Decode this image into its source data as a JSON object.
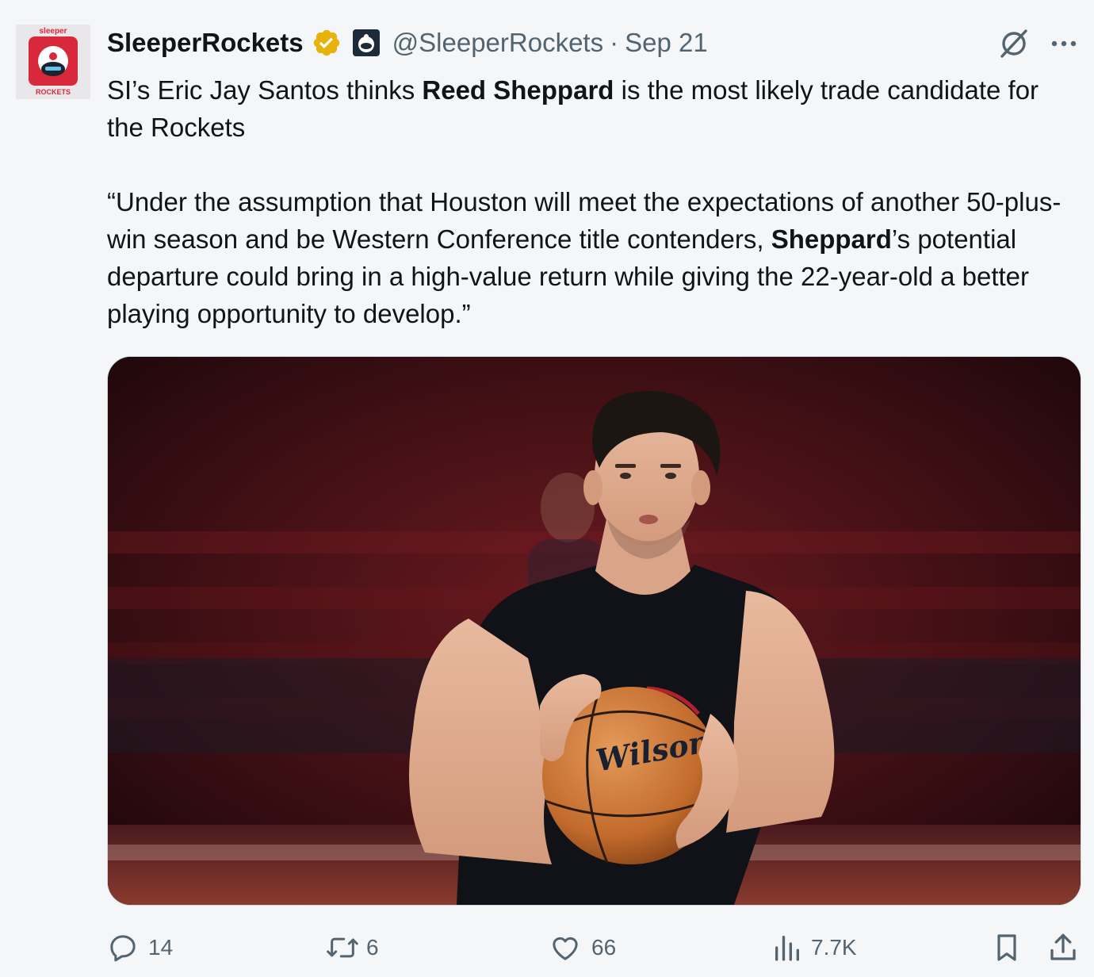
{
  "author": {
    "display_name": "SleeperRockets",
    "handle": "@SleeperRockets",
    "separator": "·",
    "date": "Sep 21",
    "avatar_top_text": "sleeper",
    "avatar_bottom_text": "ROCKETS",
    "verified_icon": "verified-badge-icon",
    "affiliation_icon": "robot-affiliate-icon"
  },
  "tweet": {
    "p1_a": "SI’s Eric Jay Santos thinks ",
    "p1_bold": "Reed Sheppard",
    "p1_b": " is the most likely trade candidate for the Rockets",
    "p2_a": "“Under the assumption that Houston will meet the expectations of another 50-plus-win season and be Western Conference title contenders, ",
    "p2_bold": "Sheppard",
    "p2_b": "’s potential departure could bring in a high-value return while giving the 22-year-old a better playing opportunity to develop.”"
  },
  "media": {
    "ball_text": "Wilson"
  },
  "actions": {
    "replies": "14",
    "reposts": "6",
    "likes": "66",
    "views": "7.7K"
  },
  "colors": {
    "text_primary": "#0f1419",
    "text_secondary": "#536471",
    "verified_gold": "#e8b20c",
    "avatar_red": "#d8283c"
  }
}
